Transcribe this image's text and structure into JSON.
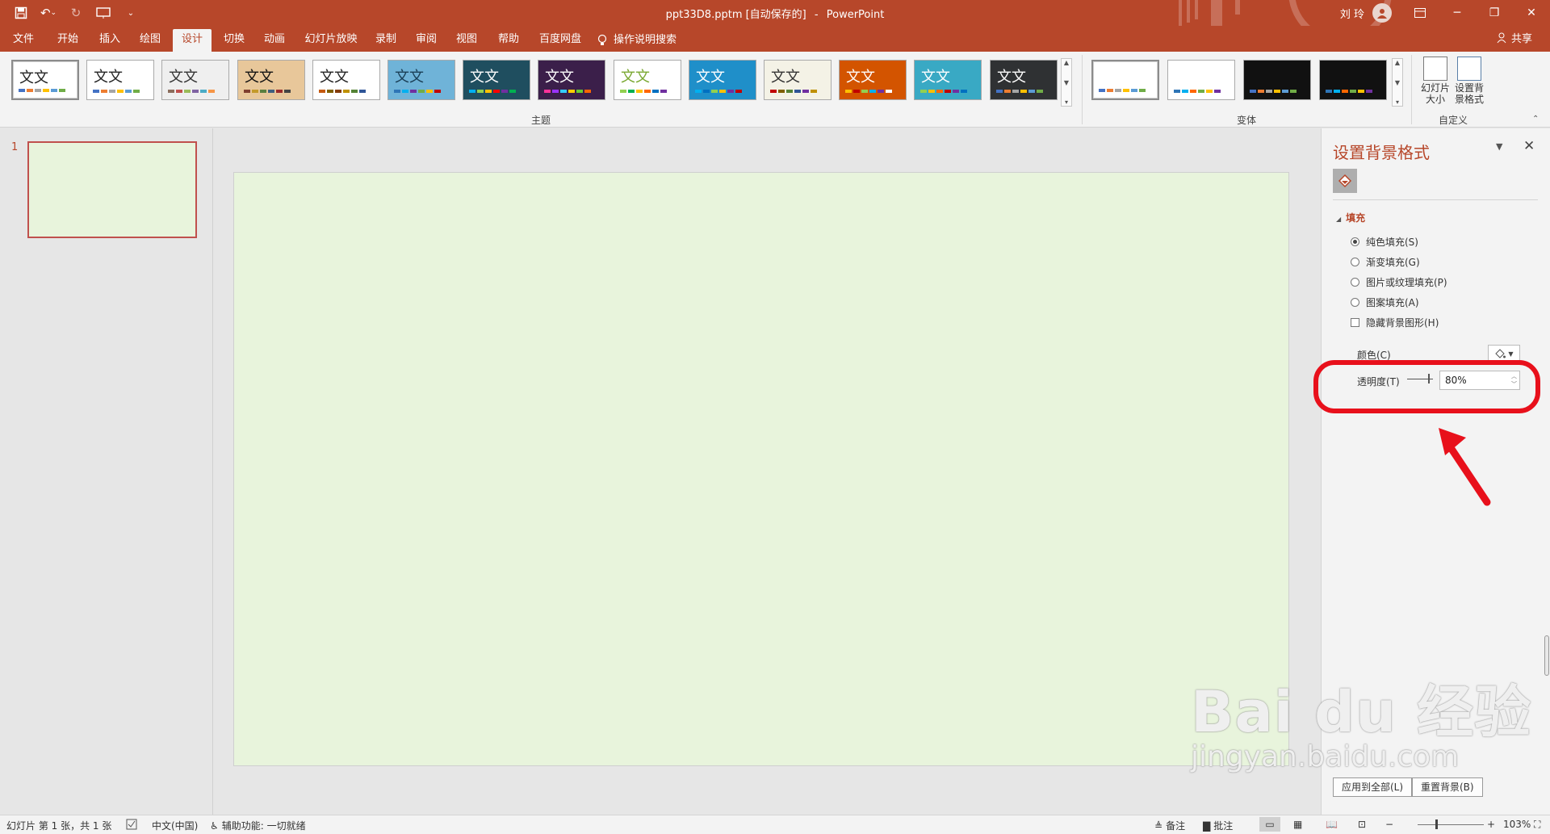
{
  "title_bar": {
    "doc_name": "ppt33D8.pptm [自动保存的]",
    "separator": "-",
    "app_name": "PowerPoint",
    "user_name": "刘 玲"
  },
  "ribbon_tabs": [
    {
      "label": "文件"
    },
    {
      "label": "开始"
    },
    {
      "label": "插入"
    },
    {
      "label": "绘图"
    },
    {
      "label": "设计"
    },
    {
      "label": "切换"
    },
    {
      "label": "动画"
    },
    {
      "label": "幻灯片放映"
    },
    {
      "label": "录制"
    },
    {
      "label": "审阅"
    },
    {
      "label": "视图"
    },
    {
      "label": "帮助"
    },
    {
      "label": "百度网盘"
    }
  ],
  "active_tab": "设计",
  "tell_me": "操作说明搜索",
  "share": "共享",
  "themes": {
    "label": "主题",
    "sample_text": "文文",
    "items": [
      {
        "bg": "#ffffff",
        "fg": "#222222",
        "colors": [
          "#4472c4",
          "#ed7d31",
          "#a5a5a5",
          "#ffc000",
          "#5b9bd5",
          "#70ad47"
        ]
      },
      {
        "bg": "#ffffff",
        "fg": "#222222",
        "colors": [
          "#4472c4",
          "#ed7d31",
          "#a5a5a5",
          "#ffc000",
          "#5b9bd5",
          "#70ad47"
        ]
      },
      {
        "bg": "#efefef",
        "fg": "#333333",
        "colors": [
          "#8b6d5c",
          "#c0504d",
          "#9bbb59",
          "#8064a2",
          "#4bacc6",
          "#f79646"
        ]
      },
      {
        "bg": "#e8c79a",
        "fg": "#111111",
        "colors": [
          "#7f3f2f",
          "#c49a2a",
          "#5a7f3f",
          "#3f5f7f",
          "#9a2a2a",
          "#444444"
        ]
      },
      {
        "bg": "#ffffff",
        "fg": "#222222",
        "colors": [
          "#c55a11",
          "#7f6000",
          "#843c0c",
          "#bf9000",
          "#548235",
          "#2f5597"
        ]
      },
      {
        "bg": "#6fb3d8",
        "fg": "#1a3e55",
        "colors": [
          "#2e75b6",
          "#00b0f0",
          "#7030a0",
          "#70ad47",
          "#ffc000",
          "#c00000"
        ]
      },
      {
        "bg": "#1f4e5f",
        "fg": "#ffffff",
        "colors": [
          "#00b0f0",
          "#92d050",
          "#ffc000",
          "#ff0000",
          "#7030a0",
          "#00b050"
        ]
      },
      {
        "bg": "#3b1f4a",
        "fg": "#ffffff",
        "colors": [
          "#ff3399",
          "#9933ff",
          "#33ccff",
          "#ffcc00",
          "#66cc33",
          "#ff6600"
        ]
      },
      {
        "bg": "#ffffff",
        "fg": "#7aa832",
        "colors": [
          "#92d050",
          "#00b050",
          "#ffc000",
          "#ff6600",
          "#0070c0",
          "#7030a0"
        ]
      },
      {
        "bg": "#1f8fc9",
        "fg": "#ffffff",
        "colors": [
          "#00b0f0",
          "#0070c0",
          "#92d050",
          "#ffc000",
          "#7030a0",
          "#c00000"
        ]
      },
      {
        "bg": "#f4f2e6",
        "fg": "#333333",
        "colors": [
          "#c00000",
          "#7f6000",
          "#548235",
          "#2f5597",
          "#7030a0",
          "#bf9000"
        ]
      },
      {
        "bg": "#d35400",
        "fg": "#ffffff",
        "colors": [
          "#ffc000",
          "#c00000",
          "#92d050",
          "#00b0f0",
          "#7030a0",
          "#ffffff"
        ]
      },
      {
        "bg": "#39a9c4",
        "fg": "#ffffff",
        "colors": [
          "#92d050",
          "#ffc000",
          "#ff6600",
          "#c00000",
          "#7030a0",
          "#0070c0"
        ]
      },
      {
        "bg": "#2f3133",
        "fg": "#ffffff",
        "colors": [
          "#4472c4",
          "#ed7d31",
          "#a5a5a5",
          "#ffc000",
          "#5b9bd5",
          "#70ad47"
        ]
      }
    ]
  },
  "variants": {
    "label": "变体",
    "items": [
      {
        "bg": "#ffffff",
        "colors": [
          "#4472c4",
          "#ed7d31",
          "#a5a5a5",
          "#ffc000",
          "#5b9bd5",
          "#70ad47"
        ]
      },
      {
        "bg": "#ffffff",
        "colors": [
          "#2e75b6",
          "#00b0f0",
          "#ff6600",
          "#70ad47",
          "#ffc000",
          "#7030a0"
        ]
      },
      {
        "bg": "#111111",
        "colors": [
          "#4472c4",
          "#ed7d31",
          "#a5a5a5",
          "#ffc000",
          "#5b9bd5",
          "#70ad47"
        ]
      },
      {
        "bg": "#111111",
        "colors": [
          "#2e75b6",
          "#00b0f0",
          "#ff6600",
          "#70ad47",
          "#ffc000",
          "#7030a0"
        ]
      }
    ]
  },
  "customize": {
    "label": "自定义",
    "slide_size": "幻灯片大小",
    "format_bg": "设置背景格式"
  },
  "slides": {
    "number": "1",
    "fill_color": "#e8f4dc"
  },
  "format_pane": {
    "title": "设置背景格式",
    "section": "填充",
    "options": [
      {
        "label": "纯色填充(S)",
        "selected": true
      },
      {
        "label": "渐变填充(G)",
        "selected": false
      },
      {
        "label": "图片或纹理填充(P)",
        "selected": false
      },
      {
        "label": "图案填充(A)",
        "selected": false
      }
    ],
    "hide_bg_graphics": "隐藏背景图形(H)",
    "color_label": "颜色(C)",
    "transparency_label": "透明度(T)",
    "transparency_value": "80%",
    "transparency_level": 0.8,
    "apply_all": "应用到全部(L)",
    "reset": "重置背景(B)"
  },
  "status": {
    "slide_info": "幻灯片 第 1 张，共 1 张",
    "language": "中文(中国)",
    "accessibility": "辅助功能: 一切就绪",
    "notes": "备注",
    "comments": "批注",
    "zoom": "103%"
  },
  "watermark": {
    "brand": "Bai du 经验",
    "url": "jingyan.baidu.com"
  },
  "colors": {
    "accent": "#b7472a",
    "highlight": "#e8101b",
    "slide_bg": "#e8f4dc"
  }
}
